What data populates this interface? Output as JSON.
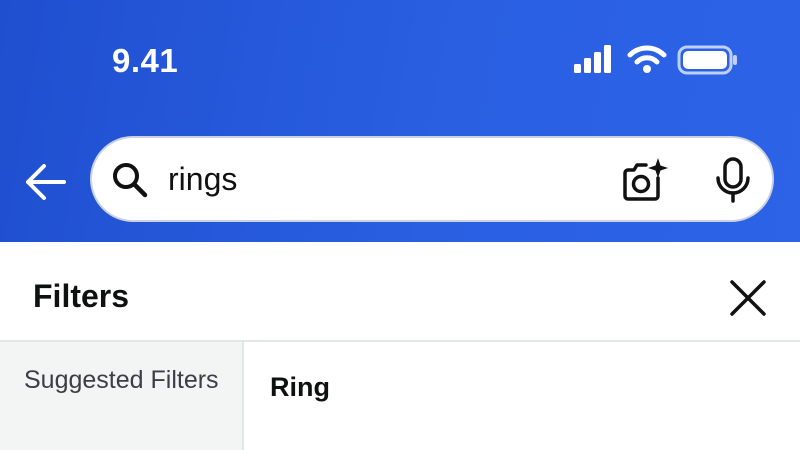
{
  "status_bar": {
    "time": "9.41",
    "icons": [
      "signal-icon",
      "wifi-icon",
      "battery-icon"
    ]
  },
  "search": {
    "query": "rings",
    "icons": {
      "back": "back-arrow-icon",
      "search": "search-icon",
      "camera": "camera-sparkle-icon",
      "mic": "microphone-icon"
    }
  },
  "filters": {
    "title": "Filters",
    "close_icon": "close-icon",
    "sidebar": [
      {
        "label": "Suggested Filters"
      }
    ],
    "section_heading": "Ring"
  },
  "colors": {
    "header_gradient_start": "#1f4fcf",
    "header_gradient_end": "#2c63e7",
    "sidebar_bg": "#f3f4f4",
    "text_primary": "#0f1111",
    "text_secondary": "#3a3f45"
  }
}
